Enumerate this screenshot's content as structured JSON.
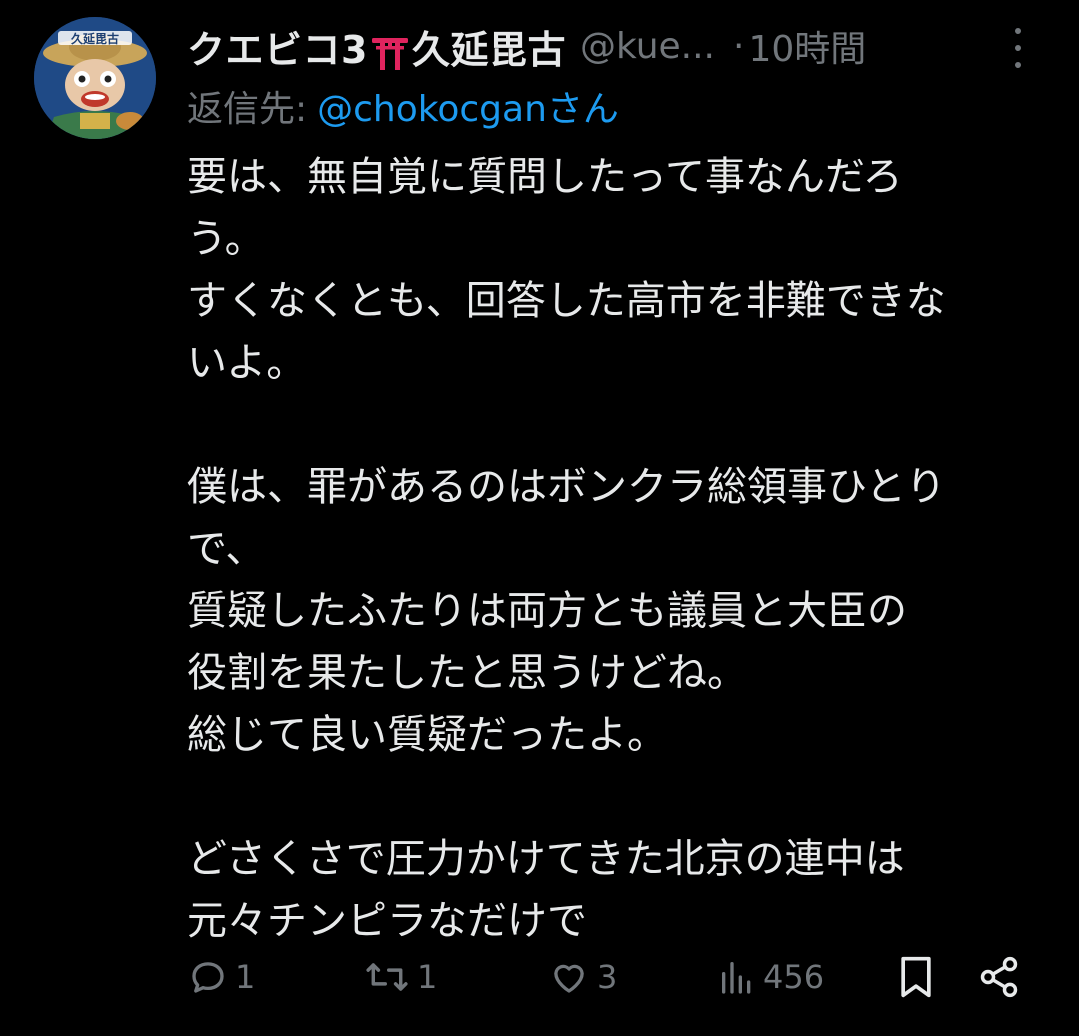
{
  "tweet": {
    "author": {
      "name_part1": "クエビコ3",
      "name_part2": "久延毘古",
      "handle": "@kue...",
      "avatar_label": "久延毘古"
    },
    "separator": "·",
    "time": "10時間",
    "reply": {
      "prefix": "返信先:",
      "target": "@chokocgan",
      "suffix": "さん"
    },
    "lines": [
      "要は、無自覚に質問したって事なんだろ",
      "う。",
      "すくなくとも、回答した高市を非難できな",
      "いよ。",
      "",
      "僕は、罪があるのはボンクラ総領事ひとり",
      "で、",
      "質疑したふたりは両方とも議員と大臣の",
      "役割を果たしたと思うけどね。",
      "総じて良い質疑だったよ。",
      "",
      "どさくさで圧力かけてきた北京の連中は",
      "元々チンピラなだけで"
    ]
  },
  "actions": {
    "replies": "1",
    "retweets": "1",
    "likes": "3",
    "views": "456"
  },
  "icons": {
    "more": "more-vertical-icon",
    "reply": "reply-icon",
    "retweet": "retweet-icon",
    "like": "heart-icon",
    "views": "views-icon",
    "bookmark": "bookmark-icon",
    "share": "share-icon",
    "torii": "torii-gate-emoji"
  },
  "colors": {
    "background": "#000000",
    "text": "#e7e9ea",
    "muted": "#71767b",
    "link": "#1d9bf0",
    "torii": "#e0245e"
  }
}
